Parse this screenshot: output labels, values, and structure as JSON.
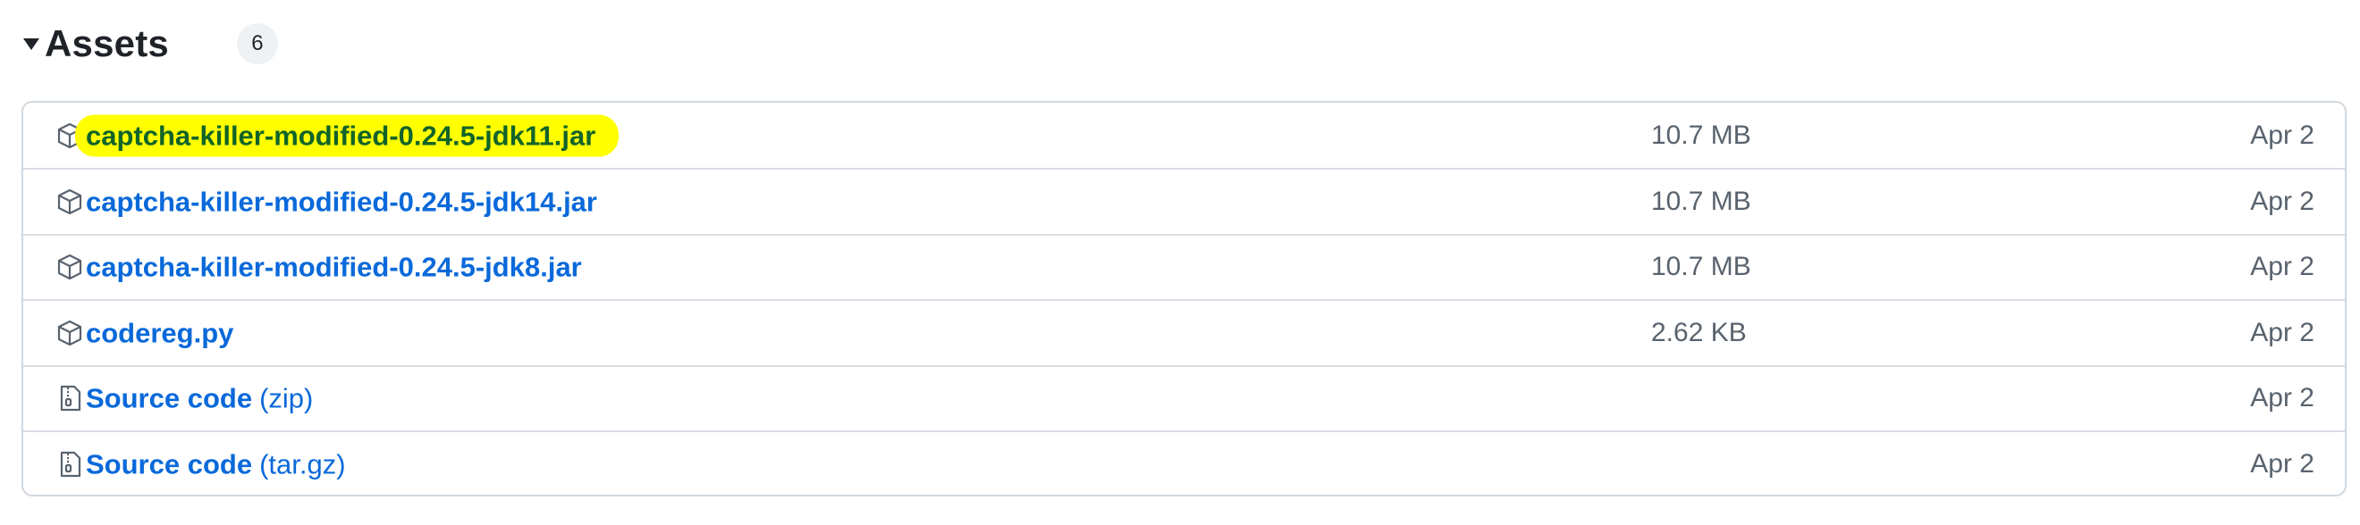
{
  "header": {
    "title": "Assets",
    "count": "6",
    "toggle_icon": "triangle-down-icon"
  },
  "assets": [
    {
      "name": "captcha-killer-modified-0.24.5-jdk11.jar",
      "suffix": "",
      "size": "10.7 MB",
      "date": "Apr 2",
      "icon": "package-icon",
      "highlighted": true
    },
    {
      "name": "captcha-killer-modified-0.24.5-jdk14.jar",
      "suffix": "",
      "size": "10.7 MB",
      "date": "Apr 2",
      "icon": "package-icon",
      "highlighted": false
    },
    {
      "name": "captcha-killer-modified-0.24.5-jdk8.jar",
      "suffix": "",
      "size": "10.7 MB",
      "date": "Apr 2",
      "icon": "package-icon",
      "highlighted": false
    },
    {
      "name": "codereg.py",
      "suffix": "",
      "size": "2.62 KB",
      "date": "Apr 2",
      "icon": "package-icon",
      "highlighted": false
    },
    {
      "name": "Source code",
      "suffix": "(zip)",
      "size": "",
      "date": "Apr 2",
      "icon": "file-zip-icon",
      "highlighted": false
    },
    {
      "name": "Source code",
      "suffix": "(tar.gz)",
      "size": "",
      "date": "Apr 2",
      "icon": "file-zip-icon",
      "highlighted": false
    }
  ],
  "colors": {
    "link": "#0969da",
    "highlight": "#ffff00",
    "muted": "#59636e",
    "border": "#d0d7de"
  }
}
